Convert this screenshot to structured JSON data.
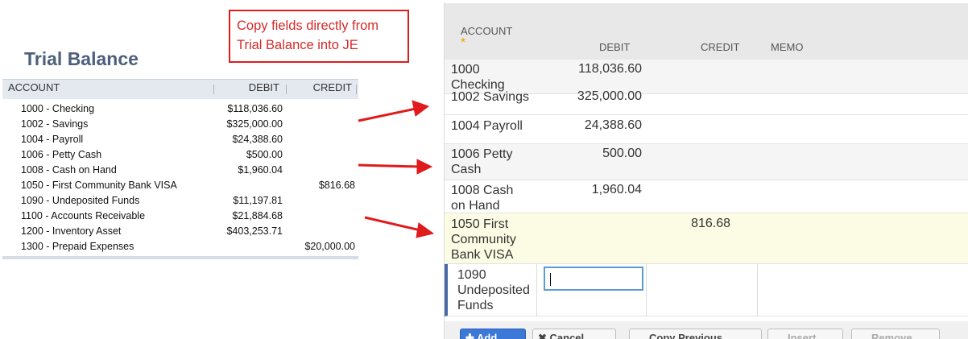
{
  "callout": {
    "line1": "Copy fields directly from",
    "line2": "Trial Balance into JE"
  },
  "trial_balance": {
    "title": "Trial Balance",
    "headers": {
      "account": "ACCOUNT",
      "debit": "DEBIT",
      "credit": "CREDIT"
    },
    "rows": [
      {
        "account": "1000 - Checking",
        "debit": "$118,036.60",
        "credit": ""
      },
      {
        "account": "1002 - Savings",
        "debit": "$325,000.00",
        "credit": ""
      },
      {
        "account": "1004 - Payroll",
        "debit": "$24,388.60",
        "credit": ""
      },
      {
        "account": "1006 - Petty Cash",
        "debit": "$500.00",
        "credit": ""
      },
      {
        "account": "1008 - Cash on Hand",
        "debit": "$1,960.04",
        "credit": ""
      },
      {
        "account": "1050 - First Community Bank VISA",
        "debit": "",
        "credit": "$816.68"
      },
      {
        "account": "1090 - Undeposited Funds",
        "debit": "$11,197.81",
        "credit": ""
      },
      {
        "account": "1100 - Accounts Receivable",
        "debit": "$21,884.68",
        "credit": ""
      },
      {
        "account": "1200 - Inventory Asset",
        "debit": "$403,253.71",
        "credit": ""
      },
      {
        "account": "1300 - Prepaid Expenses",
        "debit": "",
        "credit": "$20,000.00"
      }
    ]
  },
  "journal_entry": {
    "headers": {
      "account": "ACCOUNT",
      "required": "*",
      "debit": "DEBIT",
      "credit": "CREDIT",
      "memo": "MEMO"
    },
    "rows": [
      {
        "account_l1": "1000",
        "account_l2": "Checking",
        "account_l3": "",
        "debit": "118,036.60",
        "credit": ""
      },
      {
        "account_l1": "1002 Savings",
        "account_l2": "",
        "account_l3": "",
        "debit": "325,000.00",
        "credit": ""
      },
      {
        "account_l1": "1004 Payroll",
        "account_l2": "",
        "account_l3": "",
        "debit": "24,388.60",
        "credit": ""
      },
      {
        "account_l1": "1006 Petty",
        "account_l2": "Cash",
        "account_l3": "",
        "debit": "500.00",
        "credit": ""
      },
      {
        "account_l1": "1008 Cash",
        "account_l2": "on Hand",
        "account_l3": "",
        "debit": "1,960.04",
        "credit": ""
      },
      {
        "account_l1": "1050 First",
        "account_l2": "Community",
        "account_l3": "Bank VISA",
        "debit": "",
        "credit": "816.68"
      }
    ],
    "editing_row": {
      "account_l1": "1090",
      "account_l2": "Undeposited",
      "account_l3": "Funds",
      "debit_value": ""
    },
    "toolbar": {
      "add": "✚ Add",
      "cancel": "✖ Cancel",
      "copy_previous": "Copy Previous",
      "insert": "Insert",
      "remove": "Remove"
    }
  }
}
